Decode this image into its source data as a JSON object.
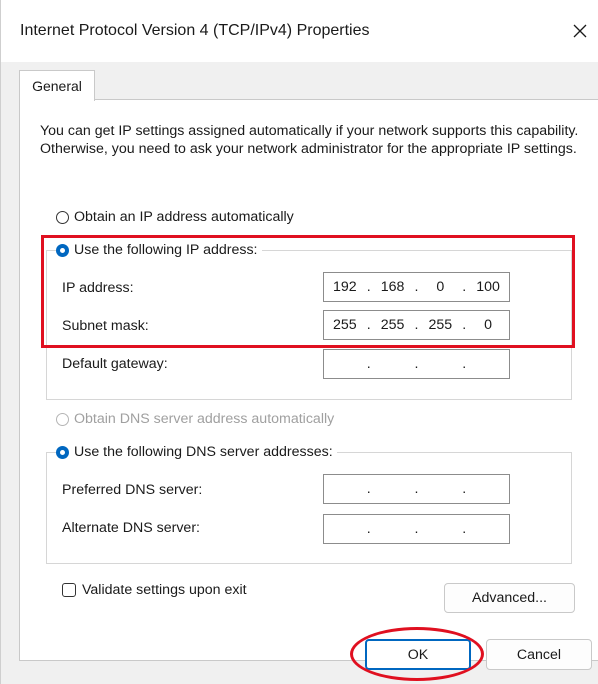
{
  "window": {
    "title": "Internet Protocol Version 4 (TCP/IPv4) Properties",
    "close_icon": "close-icon"
  },
  "tabs": [
    {
      "label": "General",
      "selected": true
    }
  ],
  "description": "You can get IP settings assigned automatically if your network supports this capability. Otherwise, you need to ask your network administrator for the appropriate IP settings.",
  "ip_section": {
    "auto_option": {
      "label": "Obtain an IP address automatically",
      "selected": false
    },
    "manual_option": {
      "label": "Use the following IP address:",
      "selected": true
    },
    "fields": [
      {
        "label": "IP address:",
        "octets": [
          "192",
          "168",
          "0",
          "100"
        ]
      },
      {
        "label": "Subnet mask:",
        "octets": [
          "255",
          "255",
          "255",
          "0"
        ]
      },
      {
        "label": "Default gateway:",
        "octets": [
          "",
          "",
          "",
          ""
        ]
      }
    ]
  },
  "dns_section": {
    "auto_option": {
      "label": "Obtain DNS server address automatically",
      "selected": false,
      "disabled": true
    },
    "manual_option": {
      "label": "Use the following DNS server addresses:",
      "selected": true
    },
    "fields": [
      {
        "label": "Preferred DNS server:",
        "octets": [
          "",
          "",
          "",
          ""
        ]
      },
      {
        "label": "Alternate DNS server:",
        "octets": [
          "",
          "",
          "",
          ""
        ]
      }
    ]
  },
  "validate": {
    "label": "Validate settings upon exit",
    "checked": false
  },
  "buttons": {
    "advanced": "Advanced...",
    "ok": "OK",
    "cancel": "Cancel"
  },
  "colors": {
    "accent": "#0067c0",
    "highlight": "#e01020"
  }
}
